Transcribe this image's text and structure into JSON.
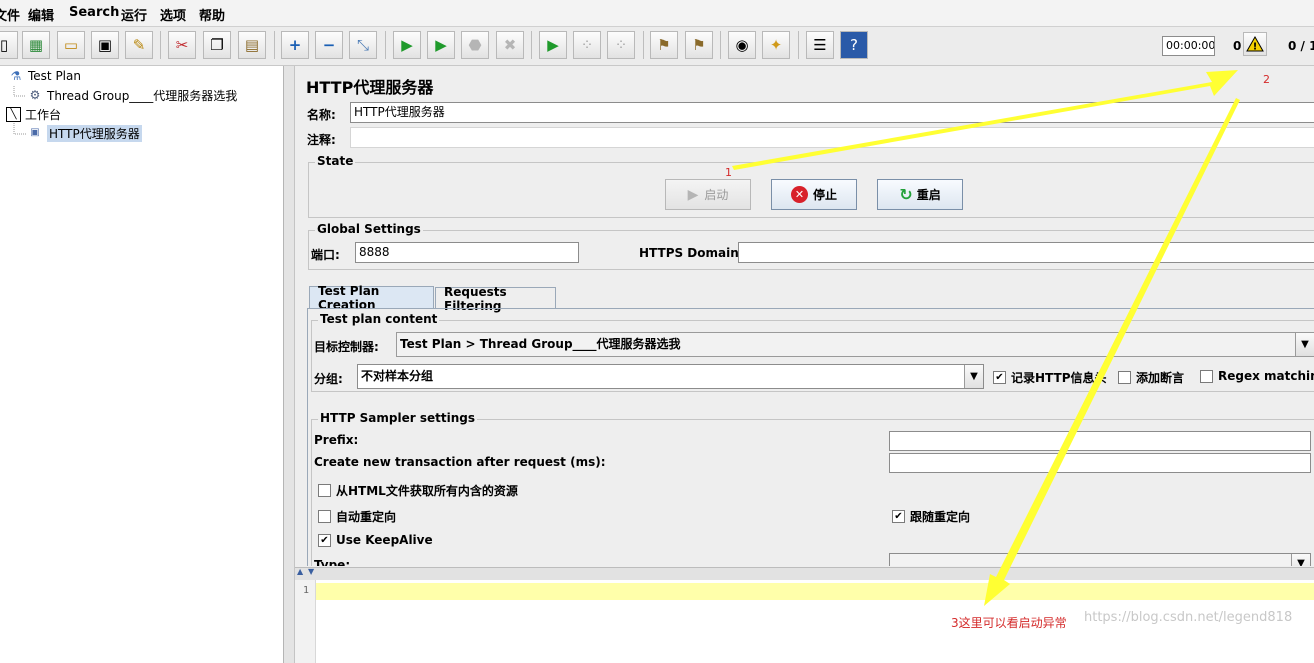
{
  "menubar": {
    "items": [
      "文件",
      "编辑",
      "Search",
      "运行",
      "选项",
      "帮助"
    ]
  },
  "toolbar": {
    "icons": [
      "new-icon",
      "templates-icon",
      "open-icon",
      "save-icon",
      "save-as-icon",
      "cut-icon",
      "copy-icon",
      "paste-icon",
      "expand-icon",
      "collapse-icon",
      "toggle-icon",
      "start-icon",
      "start-no-pause-icon",
      "stop-icon",
      "shutdown-icon",
      "remote-start-icon",
      "remote-stop-icon",
      "remote-shutdown-icon",
      "clear-icon",
      "clear-all-icon",
      "search-icon",
      "reset-search-icon",
      "function-helper-icon",
      "help-icon"
    ],
    "timer": "00:00:00",
    "warning_count": "0",
    "thread_count": "0 / 1"
  },
  "tree": {
    "items": [
      {
        "label": "Test Plan",
        "icon": "test-plan-icon"
      },
      {
        "label": "Thread Group____代理服务器选我",
        "icon": "gear-icon"
      },
      {
        "label": "工作台",
        "icon": "workbench-icon"
      },
      {
        "label": "HTTP代理服务器",
        "icon": "proxy-icon"
      }
    ]
  },
  "panel": {
    "title": "HTTP代理服务器",
    "name_label": "名称:",
    "name_value": "HTTP代理服务器",
    "comment_label": "注释:",
    "comment_value": ""
  },
  "state": {
    "title": "State",
    "start_label": "启动",
    "stop_label": "停止",
    "restart_label": "重启"
  },
  "global": {
    "title": "Global Settings",
    "port_label": "端口:",
    "port_value": "8888",
    "https_label": "HTTPS Domains:",
    "https_value": ""
  },
  "tabs": [
    {
      "label": "Test Plan Creation",
      "active": true
    },
    {
      "label": "Requests Filtering",
      "active": false
    }
  ],
  "test_plan_content": {
    "title": "Test plan content",
    "target_label": "目标控制器:",
    "target_value": "Test Plan > Thread Group____代理服务器选我",
    "group_label": "分组:",
    "group_value": "不对样本分组",
    "record_http_label": "记录HTTP信息头",
    "record_http_checked": true,
    "add_assertion_label": "添加断言",
    "add_assertion_checked": false,
    "regex_label": "Regex matching",
    "regex_checked": false
  },
  "sampler": {
    "title": "HTTP Sampler settings",
    "prefix_label": "Prefix:",
    "prefix_value": "",
    "transaction_label": "Create new transaction after request (ms):",
    "transaction_value": "",
    "retrieve_label": "从HTML文件获取所有内含的资源",
    "retrieve_checked": false,
    "auto_redirect_label": "自动重定向",
    "auto_redirect_checked": false,
    "follow_redirect_label": "跟随重定向",
    "follow_redirect_checked": true,
    "keepalive_label": "Use KeepAlive",
    "keepalive_checked": true,
    "type_label": "Type:",
    "type_value": ""
  },
  "log": {
    "line_number": "1"
  },
  "annotations": {
    "one": "1",
    "two": "2",
    "three": "3这里可以看启动异常"
  },
  "watermark": "https://blog.csdn.net/legend818",
  "colors": {
    "arrow": "#ffff33",
    "annotation": "#d42a2a",
    "log_highlight": "#ffffaa",
    "selected": "#c6d8ee"
  }
}
